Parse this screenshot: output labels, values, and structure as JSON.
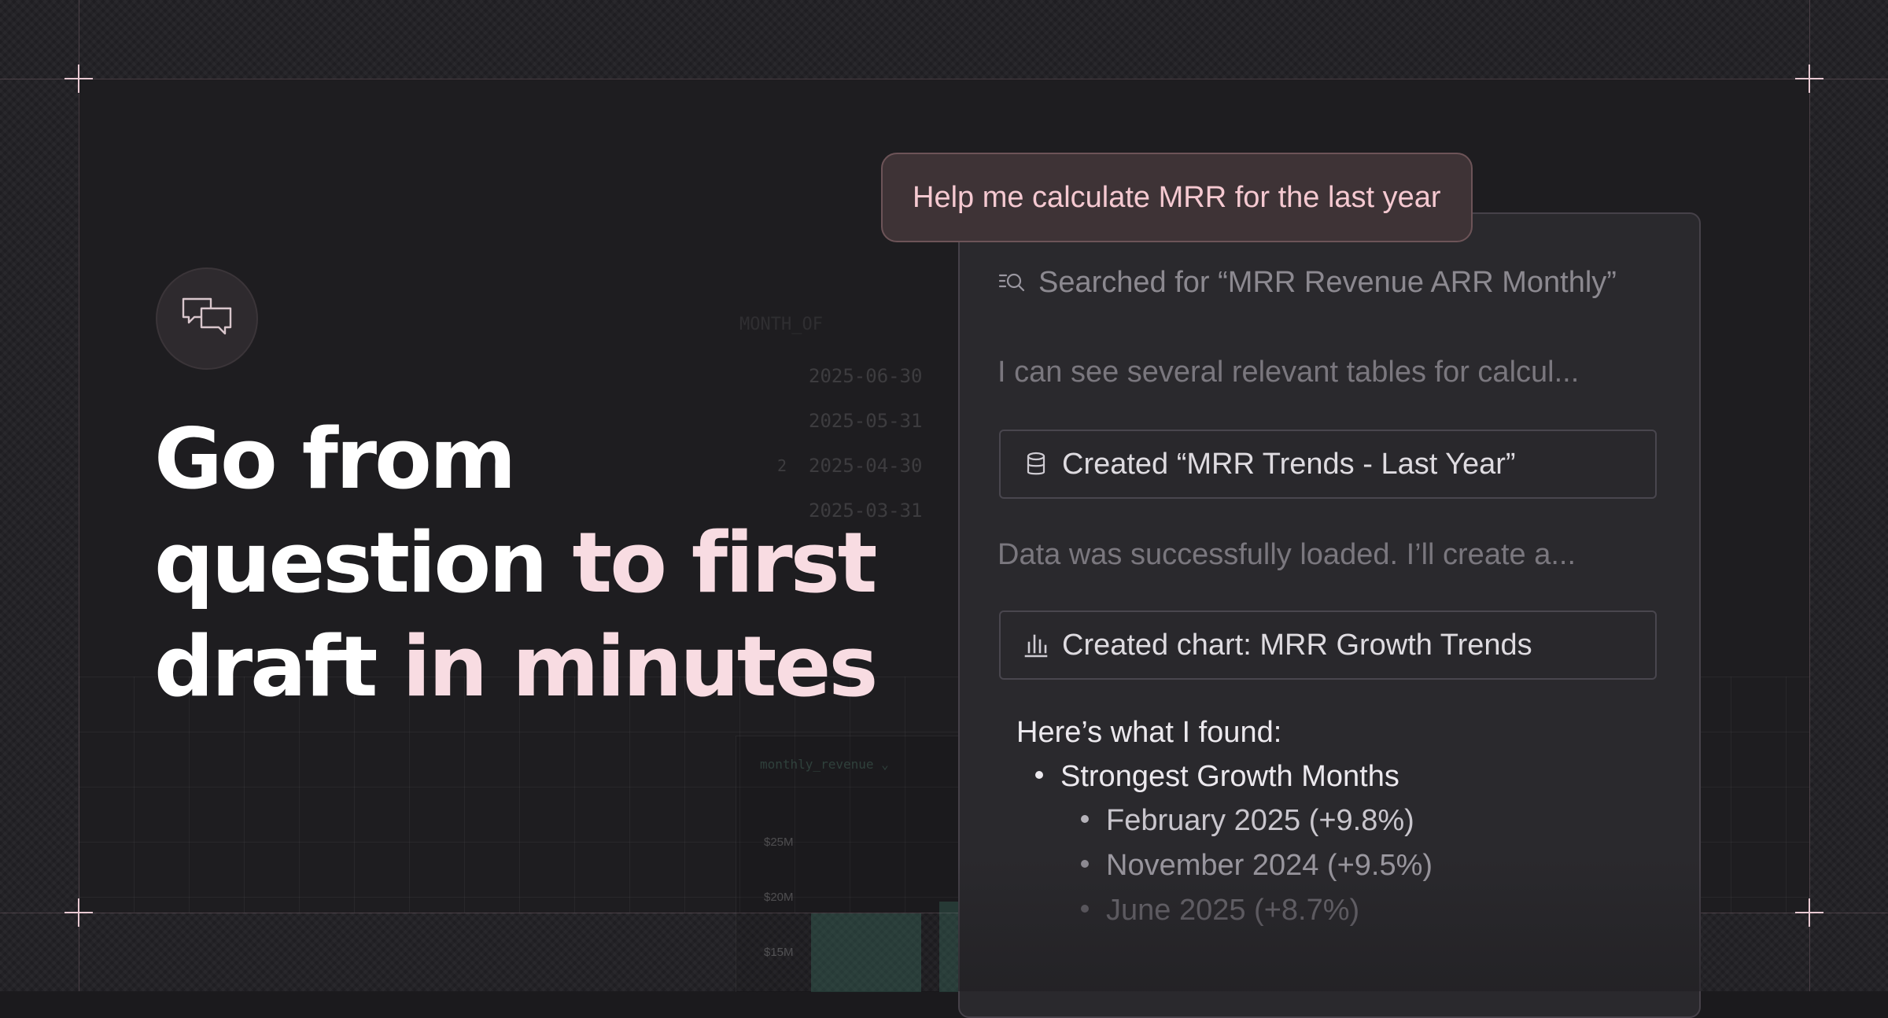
{
  "headline": {
    "line1": "Go from",
    "line2_plain": "question ",
    "line2_accent": "to first",
    "line3_plain": "draft ",
    "line3_accent": "in minutes"
  },
  "background_table": {
    "header": "MONTH_OF",
    "rows": [
      {
        "index": "",
        "date": "2025-06-30"
      },
      {
        "index": "",
        "date": "2025-05-31"
      },
      {
        "index": "2",
        "date": "2025-04-30"
      },
      {
        "index": "",
        "date": "2025-03-31"
      }
    ]
  },
  "background_chart": {
    "select_value": "monthly_revenue",
    "y_ticks": [
      "$25M",
      "$20M",
      "$15M"
    ]
  },
  "chat": {
    "prompt": "Help me calculate MRR for the last year",
    "search_step": "Searched for “MRR Revenue ARR Monthly”",
    "message_1": "I can see several relevant tables for calcul...",
    "created_table": "Created “MRR Trends - Last Year”",
    "message_2": "Data was successfully loaded. I’ll create a...",
    "created_chart": "Created chart: MRR Growth Trends",
    "found_heading": "Here’s what I found:",
    "section_title": "Strongest Growth Months",
    "months": [
      "February 2025 (+9.8%)",
      "November 2024  (+9.5%)",
      "June 2025 (+8.7%)"
    ]
  },
  "icons": {
    "badge": "chat-bubbles-icon",
    "search": "search-list-icon",
    "table": "database-icon",
    "chart": "bar-chart-icon"
  },
  "colors": {
    "accent_pink": "#f8dce2",
    "prompt_bg": "#3e3336",
    "prompt_text": "#f5c9d1",
    "panel_bg": "#2a292d"
  }
}
